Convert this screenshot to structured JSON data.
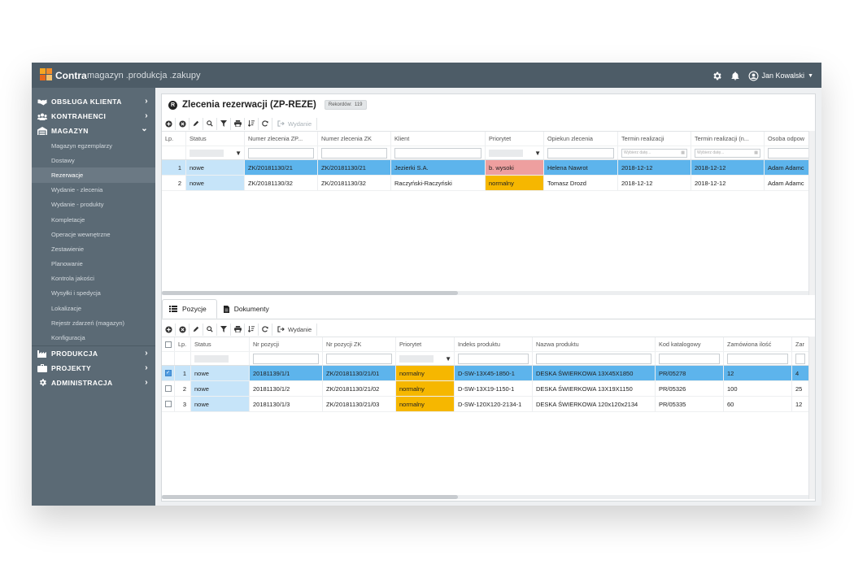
{
  "app": {
    "brand": "Contra",
    "modules": ".magazyn .produkcja .zakupy"
  },
  "header": {
    "user_name": "Jan Kowalski",
    "settings_icon": "gear-icon",
    "notifications_icon": "bell-icon",
    "user_icon": "user-circle-icon"
  },
  "sidebar": {
    "sections": [
      {
        "label": "OBSŁUGA KLIENTA",
        "icon": "handshake-icon",
        "chevron": "›"
      },
      {
        "label": "KONTRAHENCI",
        "icon": "users-icon",
        "chevron": "›"
      },
      {
        "label": "MAGAZYN",
        "icon": "warehouse-icon",
        "chevron": "⌄"
      },
      {
        "label": "PRODUKCJA",
        "icon": "factory-icon",
        "chevron": "›"
      },
      {
        "label": "PROJEKTY",
        "icon": "briefcase-icon",
        "chevron": "›"
      },
      {
        "label": "ADMINISTRACJA",
        "icon": "gear-icon",
        "chevron": "›"
      }
    ],
    "magazyn_items": [
      "Magazyn egzemplarzy",
      "Dostawy",
      "Rezerwacje",
      "Wydanie - zlecenia",
      "Wydanie - produkty",
      "Kompletacje",
      "Operacje wewnętrzne",
      "Zestawienie",
      "Planowanie",
      "Kontrola jakości",
      "Wysyłki i spedycja",
      "Lokalizacje",
      "Rejestr zdarzeń (magazyn)",
      "Konfiguracja"
    ],
    "active_item": "Rezerwacje"
  },
  "panel": {
    "icon_letter": "R",
    "title": "Zlecenia rezerwacji (ZP-REZE)",
    "records_label": "Rekordów:",
    "records_count": "119"
  },
  "toolbar": {
    "wydanie_label": "Wydanie"
  },
  "top_grid": {
    "columns": [
      "Lp.",
      "Status",
      "Numer zlecenia ZP...",
      "Numer zlecenia ZK",
      "Klient",
      "Priorytet",
      "Opiekun zlecenia",
      "Termin realizacji",
      "Termin realizacji (n...",
      "Osoba odpow"
    ],
    "date_placeholder": "Wybierz datę...",
    "rows": [
      {
        "lp": "1",
        "status": "nowe",
        "zp": "ZK/20181130/21",
        "zk": "ZK/20181130/21",
        "klient": "Jezierki S.A.",
        "priorytet": "b. wysoki",
        "opiekun": "Helena Nawrot",
        "termin": "2018-12-12",
        "termin_n": "2018-12-12",
        "osoba": "Adam Adamc"
      },
      {
        "lp": "2",
        "status": "nowe",
        "zp": "ZK/20181130/32",
        "zk": "ZK/20181130/32",
        "klient": "Raczyński-Raczyński",
        "priorytet": "normalny",
        "opiekun": "Tomasz Drozd",
        "termin": "2018-12-12",
        "termin_n": "2018-12-12",
        "osoba": "Adam Adamc"
      }
    ]
  },
  "tabs": [
    {
      "label": "Pozycje",
      "icon": "list-icon"
    },
    {
      "label": "Dokumenty",
      "icon": "document-icon"
    }
  ],
  "bottom_grid": {
    "columns": [
      "Lp.",
      "Status",
      "Nr pozycji",
      "Nr pozycji ZK",
      "Priorytet",
      "Indeks produktu",
      "Nazwa produktu",
      "Kod katalogowy",
      "Zamówiona ilość",
      "Zar"
    ],
    "rows": [
      {
        "lp": "1",
        "status": "nowe",
        "nr": "20181139/1/1",
        "nrzk": "ZK/20181130/21/01",
        "priorytet": "normalny",
        "indeks": "D-SW-13X45-1850-1",
        "nazwa": "DESKA ŚWIERKOWA  13X45X1850",
        "kod": "PR/05278",
        "ilosc": "12",
        "zar": "4",
        "checked": true
      },
      {
        "lp": "2",
        "status": "nowe",
        "nr": "20181130/1/2",
        "nrzk": "ZK/20181130/21/02",
        "priorytet": "normalny",
        "indeks": "D-SW-13X19-1150-1",
        "nazwa": "DESKA ŚWIERKOWA  13X19X1150",
        "kod": "PR/05326",
        "ilosc": "100",
        "zar": "25",
        "checked": false
      },
      {
        "lp": "3",
        "status": "nowe",
        "nr": "20181130/1/3",
        "nrzk": "ZK/20181130/21/03",
        "priorytet": "normalny",
        "indeks": "D-SW-120X120-2134-1",
        "nazwa": "DESKA ŚWIERKOWA  120x120x2134",
        "kod": "PR/05335",
        "ilosc": "60",
        "zar": "12",
        "checked": false
      }
    ]
  },
  "colors": {
    "topbar": "#4d5c67",
    "sidebar": "#5b6a75",
    "selected_row": "#5db4ec",
    "priority_high": "#ee9f9f",
    "priority_normal": "#f6b700",
    "logo": "#f28c28"
  }
}
